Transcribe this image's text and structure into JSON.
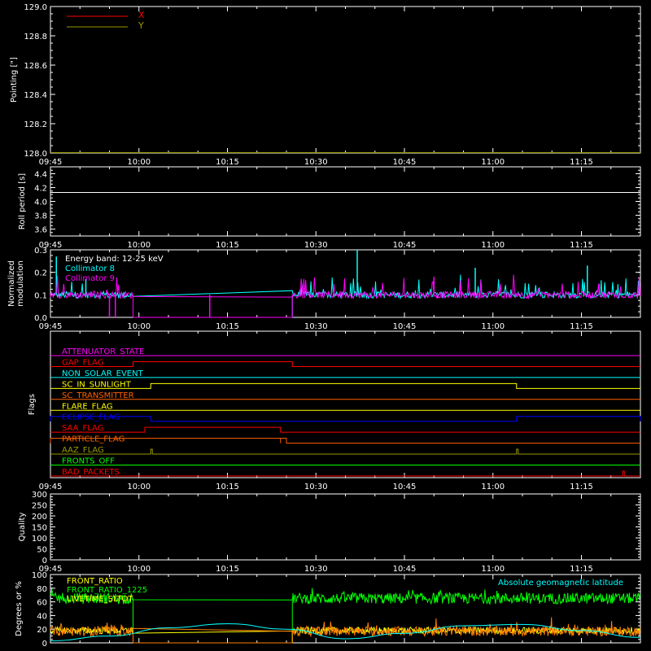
{
  "time_axis": {
    "tick_labels": [
      "09:45",
      "10:00",
      "10:15",
      "10:30",
      "10:45",
      "11:00",
      "11:15"
    ],
    "start": "09:45",
    "end": "11:25"
  },
  "colors": {
    "background": "#000000",
    "axes": "#ffffff",
    "x": "#ff0000",
    "y": "#999900",
    "cyan": "#00ffff",
    "magenta": "#ff00ff",
    "green": "#00ff00",
    "orange": "#ff8000",
    "yellow": "#ffff00",
    "blue": "#0000ff",
    "red": "#ff0000",
    "dark_orange": "#ff6000",
    "olive": "#999900"
  },
  "chart_data": [
    {
      "type": "line",
      "ylabel": "Pointing [\"]",
      "ylim": [
        128.0,
        129.0
      ],
      "yticks": [
        "128.0",
        "128.2",
        "128.4",
        "128.6",
        "128.8",
        "129.0"
      ],
      "legend": {
        "placement": "top-left",
        "entries": [
          "X",
          "Y"
        ]
      },
      "series": [
        {
          "name": "X",
          "color": "#ff0000",
          "x": [
            "09:45",
            "11:25"
          ],
          "values": [
            128.0,
            128.0
          ]
        },
        {
          "name": "Y",
          "color": "#999900",
          "x": [
            "09:45",
            "11:25"
          ],
          "values": [
            128.0,
            128.0
          ]
        }
      ]
    },
    {
      "type": "line",
      "ylabel": "Roll period [s]",
      "ylim": [
        3.5,
        4.5
      ],
      "yticks": [
        "3.6",
        "3.8",
        "4.0",
        "4.2",
        "4.4"
      ],
      "series": [
        {
          "color": "#ffffff",
          "x": [
            "09:45",
            "11:25"
          ],
          "values": [
            4.13,
            4.13
          ]
        }
      ]
    },
    {
      "type": "line",
      "ylabel": "Normalized\nmodulation",
      "ylim": [
        0.0,
        0.3
      ],
      "yticks": [
        "0.0",
        "0.1",
        "0.2",
        "0.3"
      ],
      "annotation": "Energy band: 12-25 keV",
      "legend": {
        "placement": "top-left",
        "entries": [
          "Collimator 8",
          "Collimator 9"
        ]
      },
      "segments": [
        [
          "09:45",
          "09:59"
        ],
        [
          "10:26",
          "11:25"
        ]
      ],
      "level": 0.1,
      "series": [
        {
          "name": "Collimator 8",
          "color": "#00ffff"
        },
        {
          "name": "Collimator 9",
          "color": "#ff00ff"
        }
      ]
    },
    {
      "type": "step",
      "ylabel": "Flags",
      "flags": [
        {
          "label": "ATTENUATOR_STATE",
          "color": "#ff00ff",
          "high": []
        },
        {
          "label": "GAP_FLAG",
          "color": "#ff0000",
          "high": [
            [
              "09:59",
              "10:26"
            ]
          ]
        },
        {
          "label": "NON_SOLAR_EVENT",
          "color": "#00ffff",
          "high": []
        },
        {
          "label": "SC_IN_SUNLIGHT",
          "color": "#ffff00",
          "high": [
            [
              "10:02",
              "11:04"
            ]
          ]
        },
        {
          "label": "SC_TRANSMITTER",
          "color": "#ff6000",
          "high": []
        },
        {
          "label": "FLARE_FLAG",
          "color": "#ffff00",
          "high": []
        },
        {
          "label": "ECLIPSE_FLAG",
          "color": "#0000ff",
          "high": [
            [
              "09:45",
              "10:02"
            ],
            [
              "11:04",
              "11:25"
            ]
          ]
        },
        {
          "label": "SAA_FLAG",
          "color": "#ff0000",
          "high": [
            [
              "10:01",
              "10:24"
            ]
          ]
        },
        {
          "label": "PARTICLE_FLAG",
          "color": "#ff6000",
          "high": [
            [
              "09:45",
              "10:24"
            ],
            [
              "10:24",
              "10:25"
            ]
          ]
        },
        {
          "label": "AAZ_FLAG",
          "color": "#999900",
          "high": [
            [
              "10:02",
              "10:02"
            ],
            [
              "11:04",
              "11:04"
            ]
          ]
        },
        {
          "label": "FRONTS_OFF",
          "color": "#00ff00",
          "high": []
        },
        {
          "label": "BAD_PACKETS",
          "color": "#ff0000",
          "high": [
            [
              "11:22",
              "11:22"
            ]
          ]
        }
      ]
    },
    {
      "type": "line",
      "ylabel": "Quality",
      "ylim": [
        0,
        300
      ],
      "yticks": [
        "0",
        "50",
        "100",
        "150",
        "200",
        "250",
        "300"
      ],
      "series": []
    },
    {
      "type": "line",
      "ylabel": "Degrees or %",
      "ylim": [
        0,
        100
      ],
      "yticks": [
        "0",
        "20",
        "40",
        "60",
        "80",
        "100"
      ],
      "legend": {
        "placement": "top-left",
        "entries": [
          "FRONT_RATIO",
          "FRONT_RATIO_1225",
          "LIVETIME_SLTOT"
        ]
      },
      "annotation_right": "Absolute geomagnetic latitude",
      "segments": [
        [
          "09:45",
          "09:59"
        ],
        [
          "10:26",
          "11:25"
        ]
      ],
      "series": [
        {
          "name": "FRONT_RATIO",
          "color": "#ffff00",
          "level": 18
        },
        {
          "name": "FRONT_RATIO_1225",
          "color": "#00ff00",
          "level": 65
        },
        {
          "name": "LIVETIME_SLTOT",
          "color": "#ff8000",
          "level": 17
        },
        {
          "name": "Absolute geomagnetic latitude",
          "color": "#00ffff",
          "x": [
            "09:45",
            "09:55",
            "10:05",
            "10:15",
            "10:25",
            "10:35",
            "10:45",
            "10:55",
            "11:05",
            "11:15",
            "11:25"
          ],
          "values": [
            3,
            10,
            22,
            28,
            20,
            6,
            14,
            25,
            27,
            18,
            8
          ]
        }
      ]
    }
  ]
}
